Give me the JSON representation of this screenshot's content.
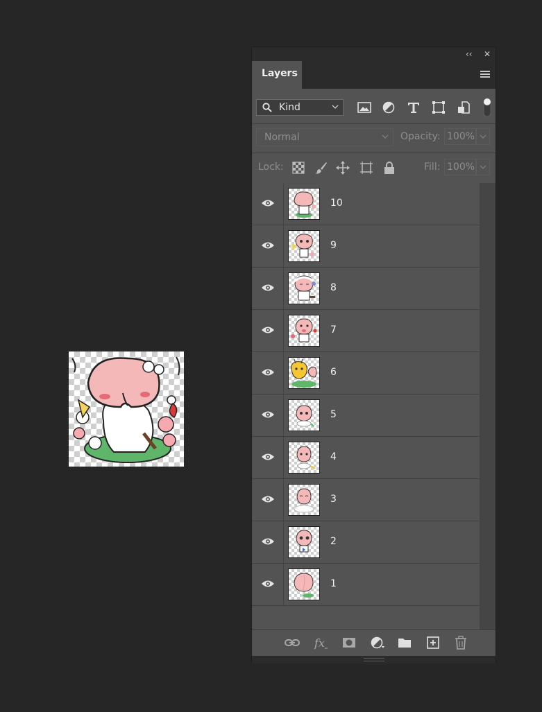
{
  "panel": {
    "collapse_glyph": "‹‹",
    "close_glyph": "✕",
    "tab_label": "Layers",
    "menu_icon": "panel-menu-icon"
  },
  "filter": {
    "kind_label": "Kind",
    "icons": [
      "pixel-layer-filter-icon",
      "adjustment-layer-filter-icon",
      "type-layer-filter-icon",
      "shape-layer-filter-icon",
      "smart-object-filter-icon"
    ]
  },
  "blend": {
    "mode": "Normal",
    "opacity_label": "Opacity:",
    "opacity_value": "100%"
  },
  "lock": {
    "lock_label": "Lock:",
    "fill_label": "Fill:",
    "fill_value": "100%",
    "icons": [
      "lock-transparent-pixels-icon",
      "lock-image-pixels-icon",
      "lock-position-icon",
      "lock-artboard-icon",
      "lock-all-icon"
    ]
  },
  "layers": [
    {
      "name": "10",
      "visible": true
    },
    {
      "name": "9",
      "visible": true
    },
    {
      "name": "8",
      "visible": true
    },
    {
      "name": "7",
      "visible": true
    },
    {
      "name": "6",
      "visible": true
    },
    {
      "name": "5",
      "visible": true
    },
    {
      "name": "4",
      "visible": true
    },
    {
      "name": "3",
      "visible": true
    },
    {
      "name": "2",
      "visible": true
    },
    {
      "name": "1",
      "visible": true
    }
  ],
  "bottom_icons": [
    "link-layers-icon",
    "add-layer-style-icon",
    "add-mask-icon",
    "new-fill-adjustment-layer-icon",
    "new-group-icon",
    "new-layer-icon",
    "delete-layer-icon"
  ],
  "colors": {
    "app_bg": "#262626",
    "panel_bg": "#535353",
    "peach": "#f5b8b8",
    "leaf": "#5fb56a"
  }
}
